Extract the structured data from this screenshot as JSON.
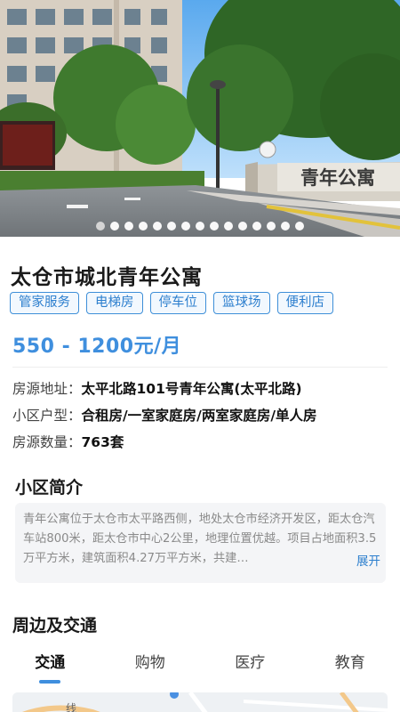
{
  "gallery": {
    "sign_text": "青年公寓",
    "total_images": 15,
    "active_index": 0
  },
  "property": {
    "title": "太仓市城北青年公寓",
    "tags": [
      "管家服务",
      "电梯房",
      "停车位",
      "篮球场",
      "便利店"
    ],
    "price": "550 - 1200元/月",
    "info": [
      {
        "label": "房源地址：",
        "value": "太平北路101号青年公寓(太平北路)"
      },
      {
        "label": "小区户型：",
        "value": "合租房/一室家庭房/两室家庭房/单人房"
      },
      {
        "label": "房源数量：",
        "value": "763套"
      }
    ]
  },
  "intro": {
    "title": "小区简介",
    "text": "青年公寓位于太仓市太平路西侧，地处太仓市经济开发区，距太仓汽车站800米，距太仓市中心2公里，地理位置优越。项目占地面积3.5万平方米，建筑面积4.27万平方米，共建…",
    "expand_label": "展开"
  },
  "nearby": {
    "title": "周边及交通",
    "tabs": [
      "交通",
      "购物",
      "医疗",
      "教育"
    ],
    "active_tab": 0,
    "map_label": "线"
  },
  "colors": {
    "accent": "#3f8fde",
    "tag_border": "#3e8fd8",
    "intro_bg": "#f4f5f7"
  }
}
